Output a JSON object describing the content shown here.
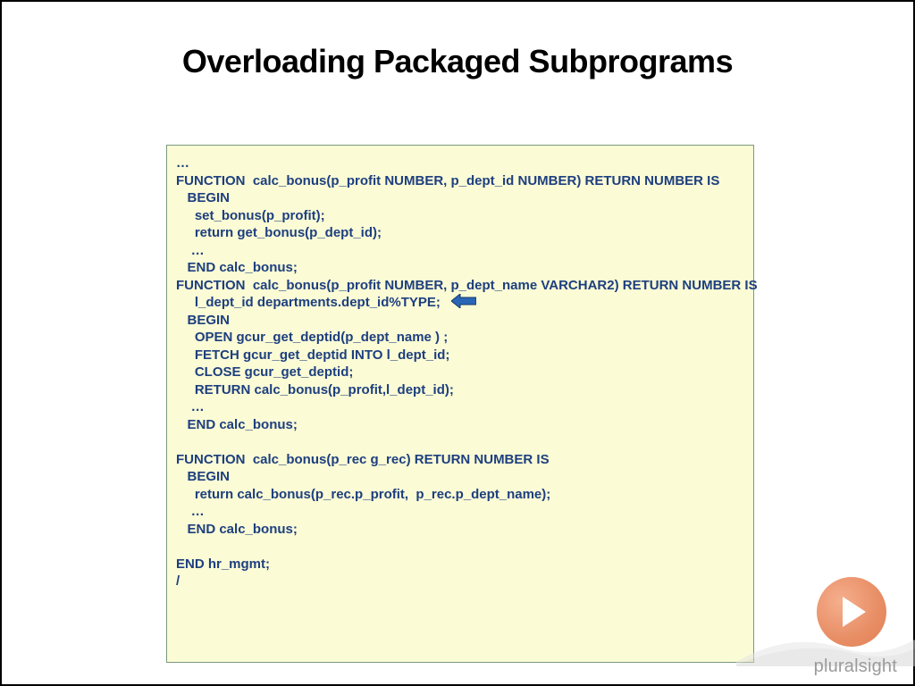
{
  "title": "Overloading Packaged Subprograms",
  "code": {
    "l01": "…",
    "l02": "FUNCTION  calc_bonus(p_profit NUMBER, p_dept_id NUMBER) RETURN NUMBER IS",
    "l03": "   BEGIN",
    "l04": "     set_bonus(p_profit);",
    "l05": "     return get_bonus(p_dept_id);",
    "l06": "    …",
    "l07": "   END calc_bonus;",
    "l08": "FUNCTION  calc_bonus(p_profit NUMBER, p_dept_name VARCHAR2) RETURN NUMBER IS",
    "l09": "     l_dept_id departments.dept_id%TYPE;",
    "l10": "   BEGIN",
    "l11": "     OPEN gcur_get_deptid(p_dept_name ) ;",
    "l12": "     FETCH gcur_get_deptid INTO l_dept_id;",
    "l13": "     CLOSE gcur_get_deptid;",
    "l14": "     RETURN calc_bonus(p_profit,l_dept_id);",
    "l15": "    …",
    "l16": "   END calc_bonus;",
    "l17": "",
    "l18": "FUNCTION  calc_bonus(p_rec g_rec) RETURN NUMBER IS",
    "l19": "   BEGIN",
    "l20": "     return calc_bonus(p_rec.p_profit,  p_rec.p_dept_name);",
    "l21": "    …",
    "l22": "   END calc_bonus;",
    "l23": "",
    "l24": "END hr_mgmt;",
    "l25": "/"
  },
  "brand": "pluralsight"
}
